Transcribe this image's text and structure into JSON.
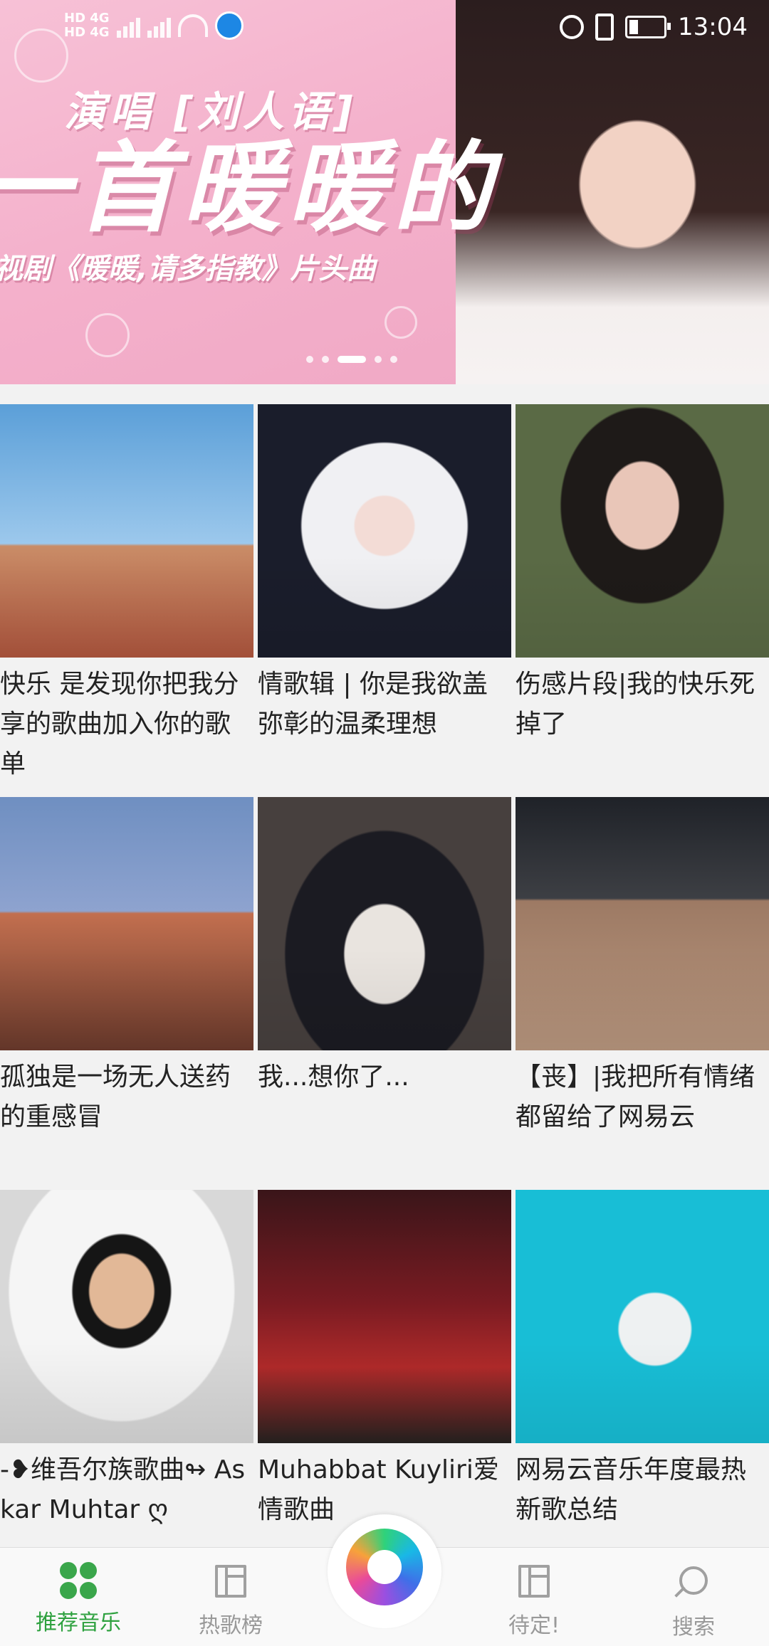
{
  "status_bar": {
    "network_left": "HD 4G",
    "network_left2": "HD 4G",
    "time": "13:04"
  },
  "banner": {
    "sing_line": "演唱 [刘人语]",
    "headline": "一首暖暖的",
    "subline": "视剧《暖暖,请多指教》片头曲",
    "page_dots": 5,
    "active_dot": 2
  },
  "playlists": [
    {
      "title": "快乐 是发现你把我分享的歌曲加入你的歌单"
    },
    {
      "title": "情歌辑 | 你是我欲盖弥彰的温柔理想"
    },
    {
      "title": "伤感片段|我的快乐死掉了"
    },
    {
      "title": "孤独是一场无人送药的重感冒"
    },
    {
      "title": "我...想你了..."
    },
    {
      "title": "【丧】|我把所有情绪都留给了网易云"
    },
    {
      "title": "-❥维吾尔族歌曲↬ Askar Muhtar ღ"
    },
    {
      "title": "Muhabbat Kuyliri爱情歌曲"
    },
    {
      "title": "网易云音乐年度最热新歌总结"
    }
  ],
  "bottom_nav": {
    "items": [
      {
        "label": "推荐音乐",
        "icon": "recommend-icon",
        "active": true
      },
      {
        "label": "热歌榜",
        "icon": "chart-book-icon",
        "active": false
      },
      {
        "label": "待定!",
        "icon": "pending-book-icon",
        "active": false
      },
      {
        "label": "搜索",
        "icon": "search-plug-icon",
        "active": false
      }
    ],
    "center_icon": "app-logo-icon"
  },
  "colors": {
    "accent": "#2ea13f",
    "banner_bg": "#f4b0cb",
    "nav_inactive": "#999999"
  }
}
